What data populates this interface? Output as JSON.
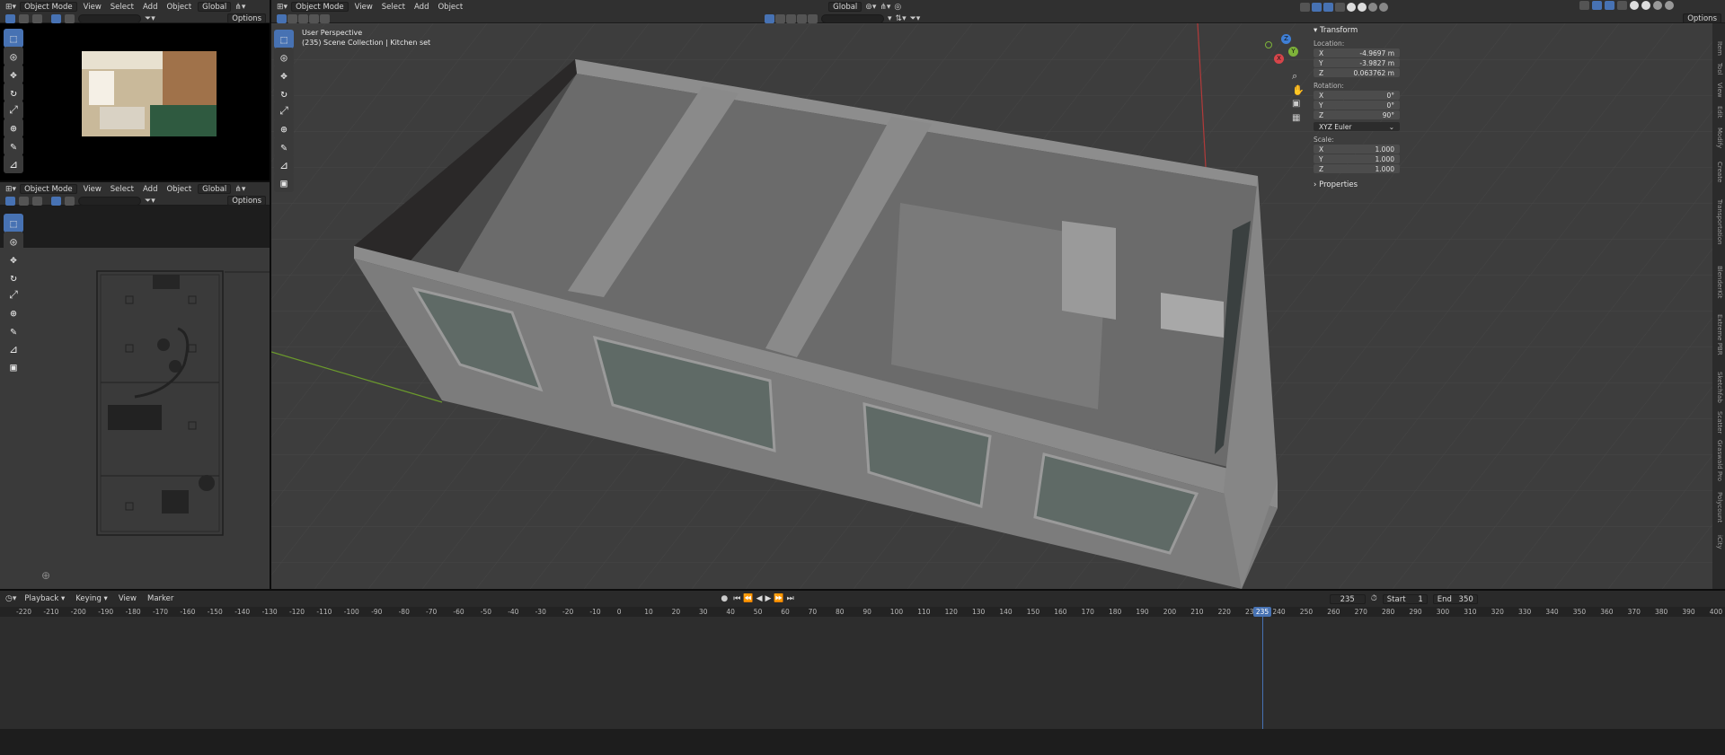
{
  "header_main": {
    "mode": "Object Mode",
    "menu": [
      "View",
      "Select",
      "Add",
      "Object"
    ],
    "transform_orientation": "Global",
    "options_label": "Options"
  },
  "header_tl": {
    "mode": "Object Mode",
    "menu": [
      "View",
      "Select",
      "Add",
      "Object"
    ],
    "transform_orientation": "Global",
    "options_label": "Options"
  },
  "header_bl": {
    "mode": "Object Mode",
    "menu": [
      "View",
      "Select",
      "Add",
      "Object"
    ],
    "transform_orientation": "Global",
    "options_label": "Options"
  },
  "viewport": {
    "perspective": "User Perspective",
    "collection": "(235) Scene Collection | Kitchen set"
  },
  "gizmo": {
    "x": "X",
    "y": "Y",
    "z": "Z"
  },
  "npanel": {
    "section": "Transform",
    "location_label": "Location:",
    "location": {
      "x": "-4.9697 m",
      "y": "-3.9827 m",
      "z": "0.063762 m"
    },
    "rotation_label": "Rotation:",
    "rotation": {
      "x": "0°",
      "y": "0°",
      "z": "90°"
    },
    "rotation_mode": "XYZ Euler",
    "scale_label": "Scale:",
    "scale": {
      "x": "1.000",
      "y": "1.000",
      "z": "1.000"
    },
    "properties_label": "Properties",
    "axis_x": "X",
    "axis_y": "Y",
    "axis_z": "Z",
    "tabs": [
      "Item",
      "Tool",
      "View",
      "Edit",
      "Modify",
      "Create",
      "Transportation",
      "BlenderKit",
      "Extreme PBR",
      "Sketchfab",
      "Scatter",
      "Graswald Pro",
      "Polycount",
      "iCity"
    ]
  },
  "timeline": {
    "menu": [
      "Playback",
      "Keying",
      "View",
      "Marker"
    ],
    "current_frame": "235",
    "start_label": "Start",
    "start": "1",
    "end_label": "End",
    "end": "350",
    "ticks": [
      "-220",
      "-210",
      "-200",
      "-190",
      "-180",
      "-170",
      "-160",
      "-150",
      "-140",
      "-130",
      "-120",
      "-110",
      "-100",
      "-90",
      "-80",
      "-70",
      "-60",
      "-50",
      "-40",
      "-30",
      "-20",
      "-10",
      "0",
      "10",
      "20",
      "30",
      "40",
      "50",
      "60",
      "70",
      "80",
      "90",
      "100",
      "110",
      "120",
      "130",
      "140",
      "150",
      "160",
      "170",
      "180",
      "190",
      "200",
      "210",
      "220",
      "230",
      "240",
      "250",
      "260",
      "270",
      "280",
      "290",
      "300",
      "310",
      "320",
      "330",
      "340",
      "350",
      "360",
      "370",
      "380",
      "390",
      "400"
    ]
  },
  "colors": {
    "accent": "#4772b3",
    "header": "#303030",
    "viewport": "#3d3d3d",
    "grid": "#474747",
    "playhead": "#4772b3"
  }
}
